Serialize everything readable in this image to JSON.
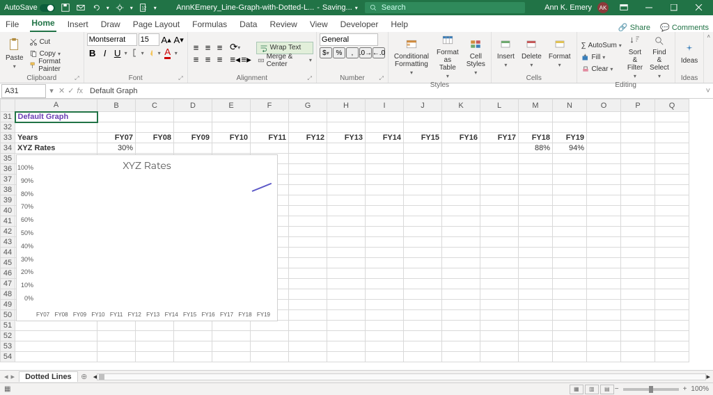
{
  "titlebar": {
    "autosave_label": "AutoSave",
    "autosave_state": "On",
    "filename": "AnnKEmery_Line-Graph-with-Dotted-L...",
    "save_status": "Saving...",
    "search_placeholder": "Search",
    "user_name": "Ann K. Emery",
    "user_initials": "AK"
  },
  "ribbon_tabs": {
    "file": "File",
    "home": "Home",
    "insert": "Insert",
    "draw": "Draw",
    "page_layout": "Page Layout",
    "formulas": "Formulas",
    "data": "Data",
    "review": "Review",
    "view": "View",
    "developer": "Developer",
    "help": "Help",
    "share": "Share",
    "comments": "Comments"
  },
  "ribbon": {
    "paste": "Paste",
    "cut": "Cut",
    "copy": "Copy",
    "format_painter": "Format Painter",
    "clipboard": "Clipboard",
    "font_name": "Montserrat",
    "font_size": "15",
    "font_group": "Font",
    "wrap_text": "Wrap Text",
    "merge_center": "Merge & Center",
    "alignment": "Alignment",
    "number_format": "General",
    "number_group": "Number",
    "conditional_formatting": "Conditional\nFormatting",
    "format_as_table": "Format as\nTable",
    "cell_styles": "Cell\nStyles",
    "styles": "Styles",
    "insert": "Insert",
    "delete": "Delete",
    "format": "Format",
    "cells": "Cells",
    "autosum": "AutoSum",
    "fill": "Fill",
    "clear": "Clear",
    "sort_filter": "Sort &\nFilter",
    "find_select": "Find &\nSelect",
    "editing": "Editing",
    "ideas": "Ideas",
    "ideas_group": "Ideas"
  },
  "fx": {
    "namebox": "A31",
    "formula": "Default Graph"
  },
  "columns": [
    "A",
    "B",
    "C",
    "D",
    "E",
    "F",
    "G",
    "H",
    "I",
    "J",
    "K",
    "L",
    "M",
    "N",
    "O",
    "P",
    "Q"
  ],
  "rows_start": 31,
  "rows_count": 24,
  "cells": {
    "A31": "Default Graph",
    "A33": "Years",
    "B33": "FY07",
    "C33": "FY08",
    "D33": "FY09",
    "E33": "FY10",
    "F33": "FY11",
    "G33": "FY12",
    "H33": "FY13",
    "I33": "FY14",
    "J33": "FY15",
    "K33": "FY16",
    "L33": "FY17",
    "M33": "FY18",
    "N33": "FY19",
    "A34": "XYZ Rates",
    "B34": "30%",
    "M34": "88%",
    "N34": "94%"
  },
  "chart_data": {
    "type": "line",
    "title": "XYZ Rates",
    "categories": [
      "FY07",
      "FY08",
      "FY09",
      "FY10",
      "FY11",
      "FY12",
      "FY13",
      "FY14",
      "FY15",
      "FY16",
      "FY17",
      "FY18",
      "FY19"
    ],
    "series": [
      {
        "name": "XYZ Rates",
        "values": [
          null,
          null,
          null,
          null,
          null,
          null,
          null,
          null,
          null,
          null,
          null,
          88,
          94
        ]
      }
    ],
    "ylim": [
      0,
      100
    ],
    "yticks": [
      "0%",
      "10%",
      "20%",
      "30%",
      "40%",
      "50%",
      "60%",
      "70%",
      "80%",
      "90%",
      "100%"
    ],
    "xlabel": "",
    "ylabel": ""
  },
  "sheet_tabs": {
    "active": "Dotted Lines"
  },
  "statusbar": {
    "zoom": "100%"
  }
}
